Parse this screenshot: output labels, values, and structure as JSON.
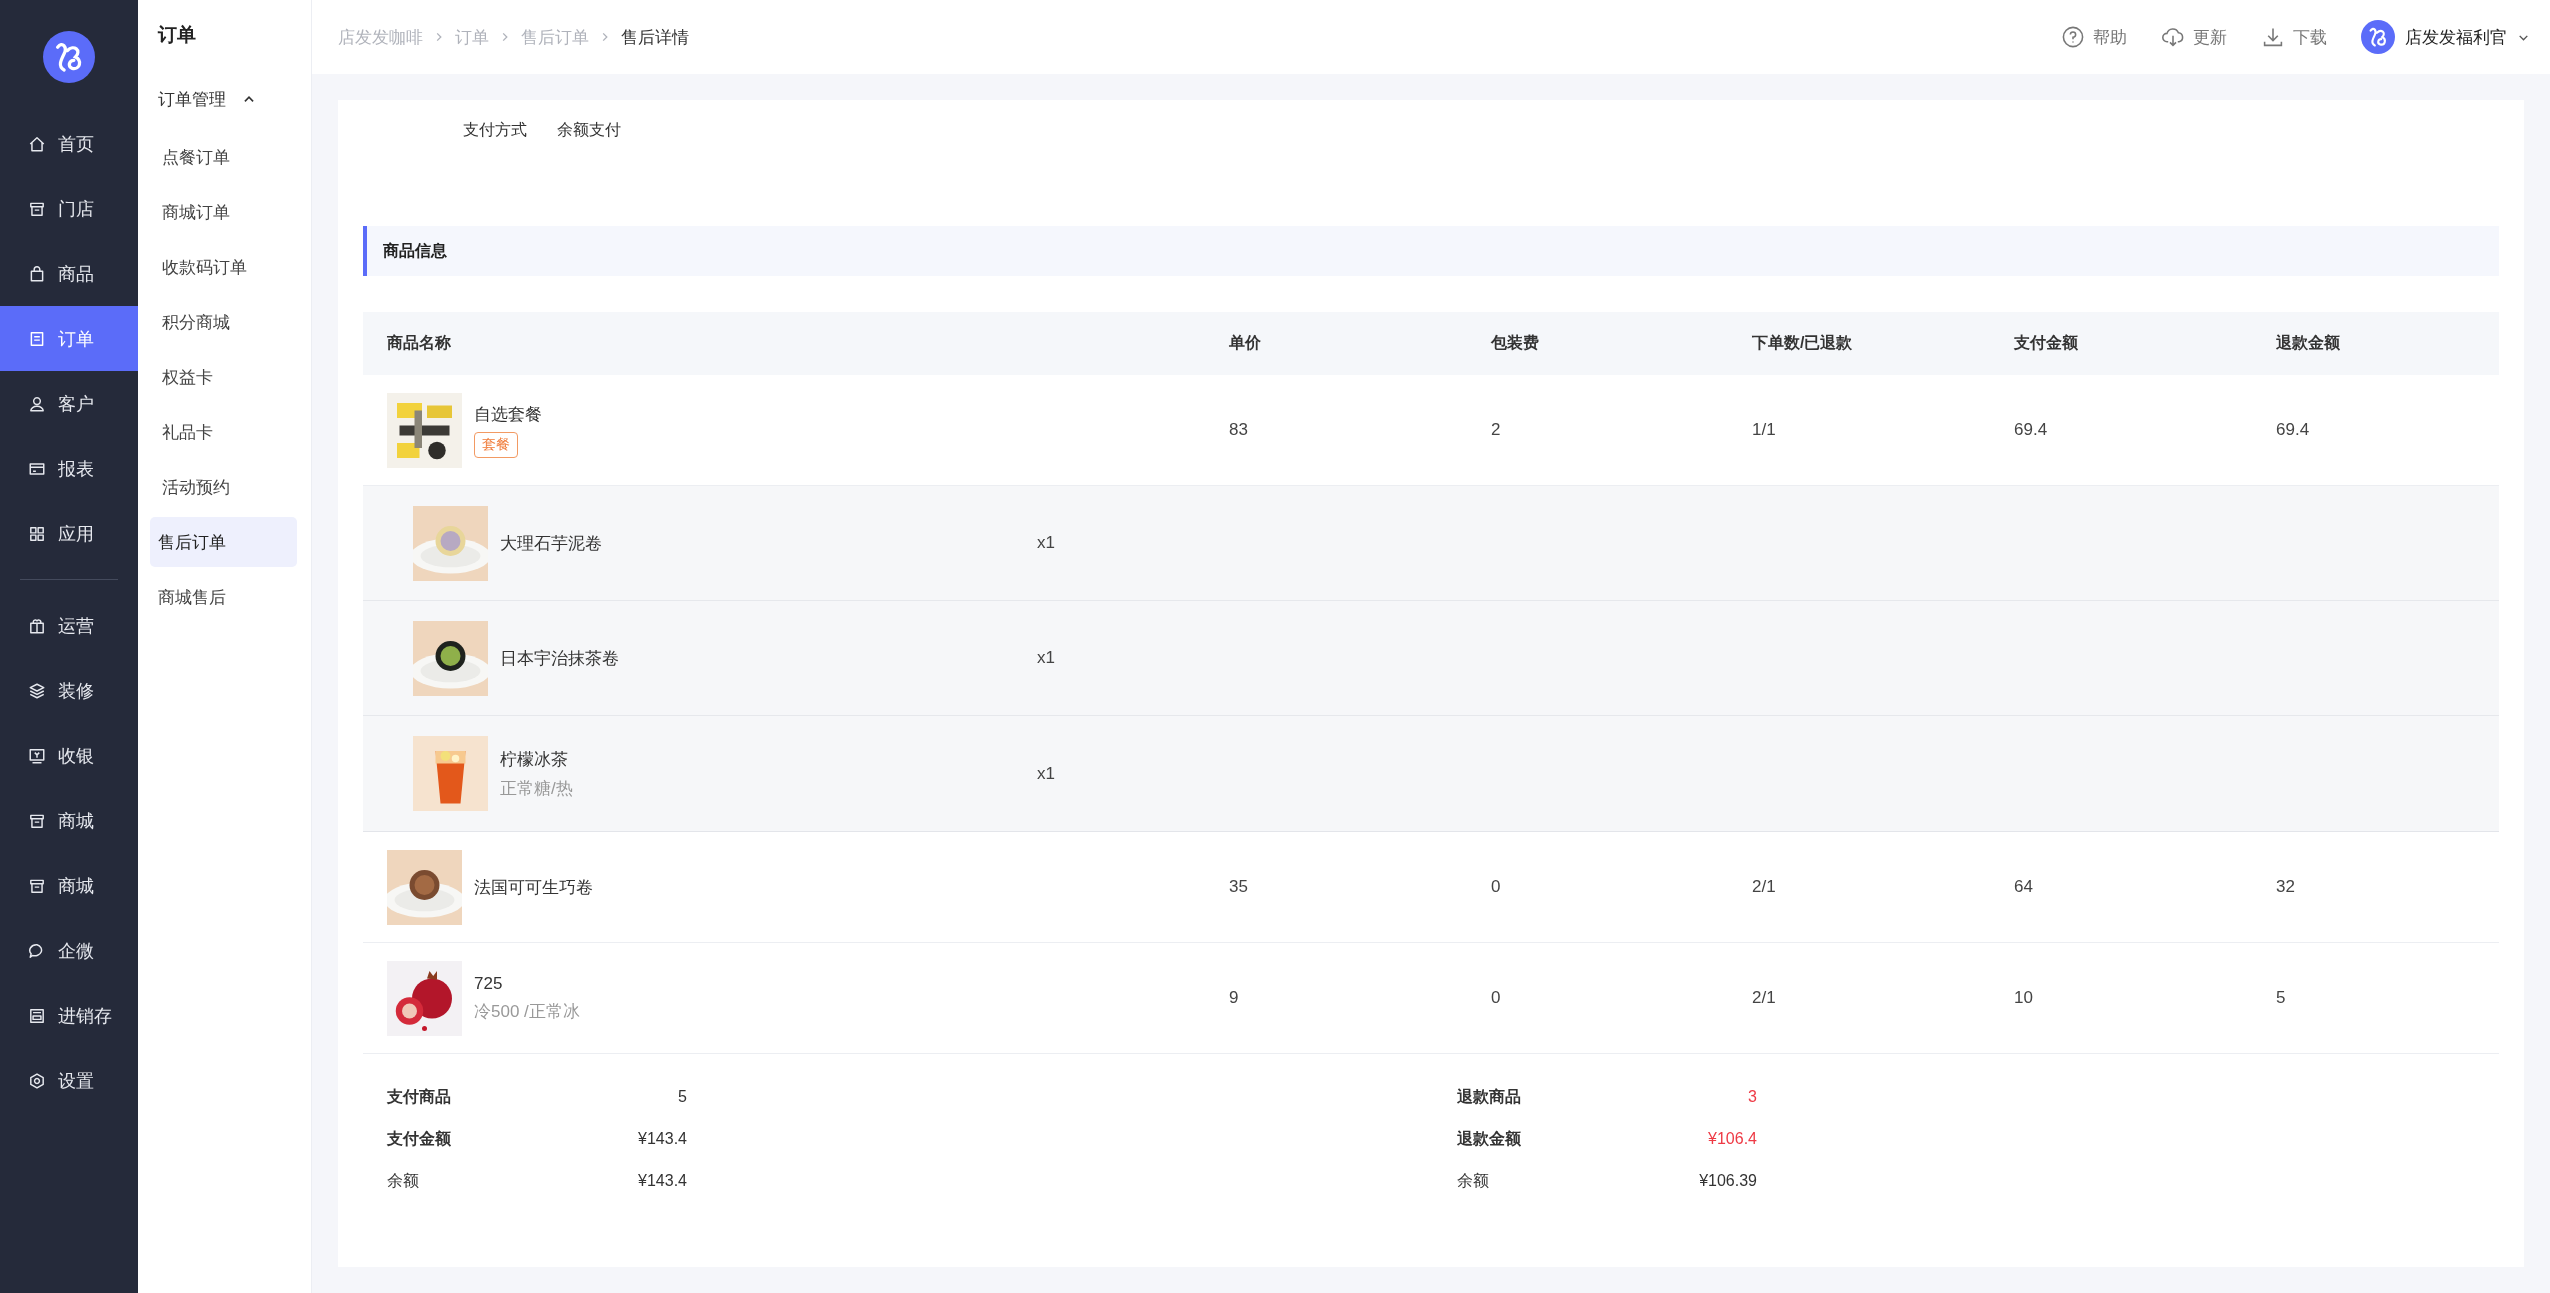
{
  "sidebar": {
    "groups": [
      [
        {
          "label": "首页",
          "selected": false
        },
        {
          "label": "门店",
          "selected": false
        },
        {
          "label": "商品",
          "selected": false
        },
        {
          "label": "订单",
          "selected": true
        },
        {
          "label": "客户",
          "selected": false
        },
        {
          "label": "报表",
          "selected": false
        },
        {
          "label": "应用",
          "selected": false
        }
      ],
      [
        {
          "label": "运营",
          "selected": false
        },
        {
          "label": "装修",
          "selected": false
        },
        {
          "label": "收银",
          "selected": false
        },
        {
          "label": "商城",
          "selected": false
        },
        {
          "label": "商城",
          "selected": false
        },
        {
          "label": "企微",
          "selected": false
        },
        {
          "label": "进销存",
          "selected": false
        },
        {
          "label": "设置",
          "selected": false
        }
      ]
    ]
  },
  "submenu": {
    "title": "订单",
    "items": [
      {
        "label": "订单管理",
        "expanded": true,
        "children": [
          {
            "label": "点餐订单",
            "selected": false
          },
          {
            "label": "商城订单",
            "selected": false
          },
          {
            "label": "收款码订单",
            "selected": false
          },
          {
            "label": "积分商城",
            "selected": false
          },
          {
            "label": "权益卡",
            "selected": false
          },
          {
            "label": "礼品卡",
            "selected": false
          },
          {
            "label": "活动预约",
            "selected": false
          }
        ]
      },
      {
        "label": "售后订单",
        "selected": true
      },
      {
        "label": "商城售后",
        "selected": false
      }
    ]
  },
  "breadcrumb": [
    "店发发咖啡",
    "订单",
    "售后订单",
    "售后详情"
  ],
  "header_actions": [
    {
      "label": "帮助"
    },
    {
      "label": "更新"
    },
    {
      "label": "下载"
    }
  ],
  "user": {
    "name": "店发发福利官"
  },
  "payment": {
    "label": "支付方式",
    "value": "余额支付"
  },
  "section_title": "商品信息",
  "table": {
    "columns": [
      "商品名称",
      "单价",
      "包装费",
      "下单数/已退款",
      "支付金额",
      "退款金额"
    ],
    "rows": [
      {
        "name": "自选套餐",
        "tag": "套餐",
        "unit_price": "83",
        "packing_fee": "2",
        "quantity": "1/1",
        "paid": "69.4",
        "refund": "69.4",
        "children": [
          {
            "name": "大理石芋泥卷",
            "quantity": "x1"
          },
          {
            "name": "日本宇治抹茶卷",
            "quantity": "x1"
          },
          {
            "name": "柠檬冰茶",
            "spec": "正常糖/热",
            "quantity": "x1"
          }
        ]
      },
      {
        "name": "法国可可生巧卷",
        "unit_price": "35",
        "packing_fee": "0",
        "quantity": "2/1",
        "paid": "64",
        "refund": "32"
      },
      {
        "name": "725",
        "spec": "冷500 /正常冰",
        "unit_price": "9",
        "packing_fee": "0",
        "quantity": "2/1",
        "paid": "10",
        "refund": "5"
      }
    ]
  },
  "summary": {
    "paid": [
      {
        "label": "支付商品",
        "value": "5",
        "bold": true,
        "alert": false
      },
      {
        "label": "支付金额",
        "value": "¥143.4",
        "bold": true,
        "alert": false
      },
      {
        "label": "余额",
        "value": "¥143.4",
        "bold": false,
        "alert": false
      }
    ],
    "refund": [
      {
        "label": "退款商品",
        "value": "3",
        "bold": true,
        "alert": true
      },
      {
        "label": "退款金额",
        "value": "¥106.4",
        "bold": true,
        "alert": true
      },
      {
        "label": "余额",
        "value": "¥106.39",
        "bold": false,
        "alert": false
      }
    ]
  }
}
